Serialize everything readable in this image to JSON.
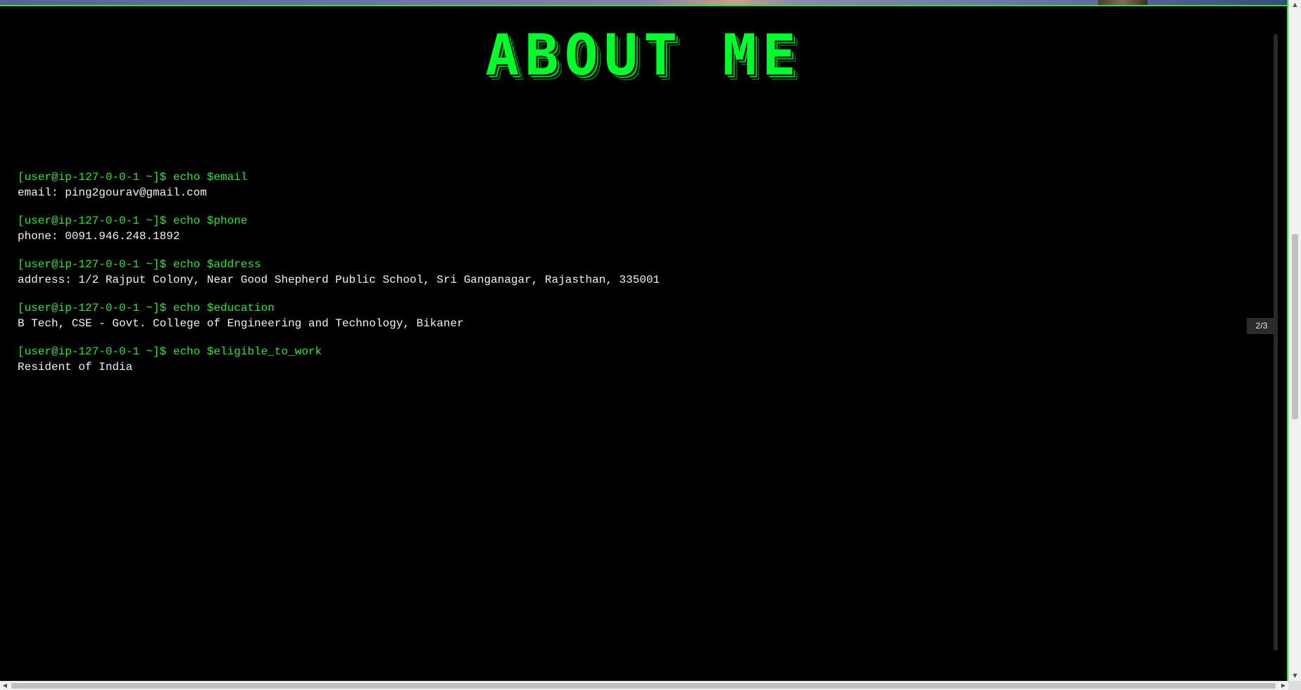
{
  "page": {
    "title": "ABOUT ME",
    "slide_indicator": "2/3",
    "colors": {
      "background": "#000000",
      "accent_green": "#2fe23a",
      "title_green": "#00ff2a",
      "output_text": "#f2f2f2"
    }
  },
  "terminal": {
    "entries": [
      {
        "prompt": "[user@ip-127-0-0-1 ~]$ echo $email",
        "output": "email: ping2gourav@gmail.com"
      },
      {
        "prompt": "[user@ip-127-0-0-1 ~]$ echo $phone",
        "output": "phone: 0091.946.248.1892"
      },
      {
        "prompt": "[user@ip-127-0-0-1 ~]$ echo $address",
        "output": "address: 1/2 Rajput Colony, Near Good Shepherd Public School, Sri Ganganagar, Rajasthan, 335001"
      },
      {
        "prompt": "[user@ip-127-0-0-1 ~]$ echo $education",
        "output": "B Tech, CSE - Govt. College of Engineering and Technology, Bikaner"
      },
      {
        "prompt": "[user@ip-127-0-0-1 ~]$ echo $eligible_to_work",
        "output": "Resident of India"
      }
    ]
  },
  "scrollbars": {
    "up_icon": "▲",
    "down_icon": "▼",
    "left_icon": "◀",
    "right_icon": "▶"
  }
}
